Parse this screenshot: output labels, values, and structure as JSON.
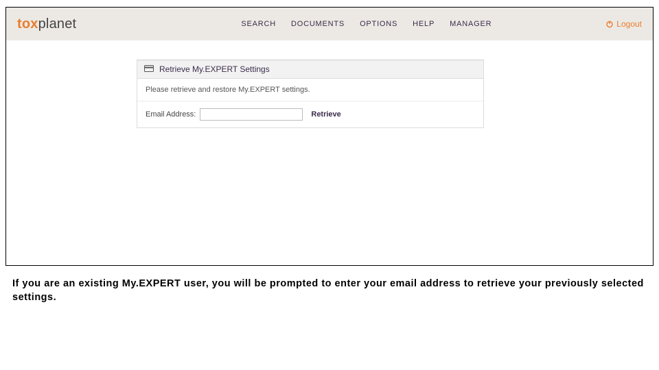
{
  "brand": {
    "tox": "tox",
    "planet": "planet"
  },
  "nav": {
    "search": "SEARCH",
    "documents": "DOCUMENTS",
    "options": "OPTIONS",
    "help": "HELP",
    "manager": "MANAGER"
  },
  "logout": {
    "label": "Logout"
  },
  "panel": {
    "title": "Retrieve My.EXPERT Settings",
    "instruction": "Please retrieve and restore My.EXPERT settings.",
    "email_label": "Email Address:",
    "email_value": "",
    "retrieve_label": "Retrieve"
  },
  "caption": "If you are an existing My.EXPERT user, you will be prompted to enter your email address to retrieve your previously selected settings."
}
